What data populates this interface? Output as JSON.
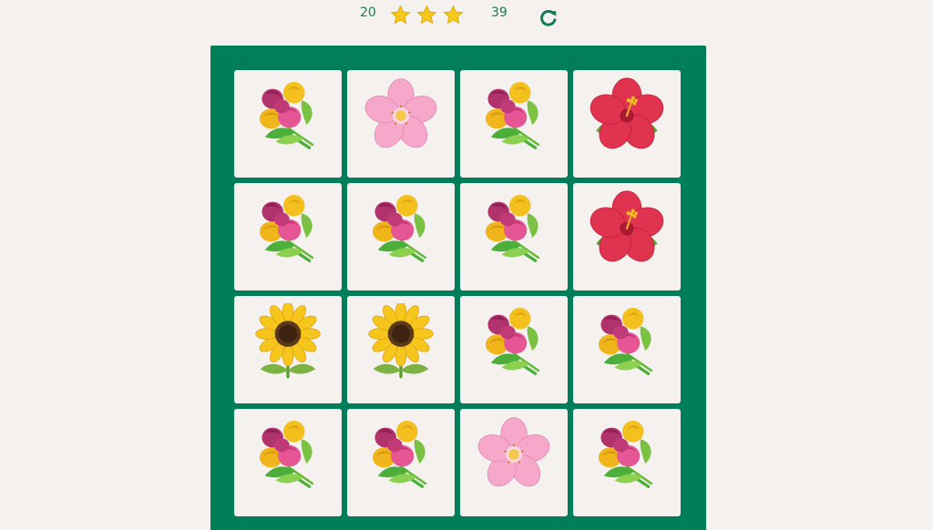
{
  "scoreboard": {
    "moves": "20",
    "timer": "39",
    "stars_filled": 3,
    "star_color": "#f6c619",
    "restart_icon": "restart-icon"
  },
  "board": {
    "background_color": "#007e5a",
    "card_color": "#f5f1ef",
    "rows": 4,
    "columns": 4,
    "cards": [
      {
        "emoji": "bouquet",
        "state": "open"
      },
      {
        "emoji": "cherry-blossom",
        "state": "open"
      },
      {
        "emoji": "bouquet",
        "state": "open"
      },
      {
        "emoji": "hibiscus",
        "state": "open"
      },
      {
        "emoji": "bouquet",
        "state": "open"
      },
      {
        "emoji": "bouquet",
        "state": "open"
      },
      {
        "emoji": "bouquet",
        "state": "open"
      },
      {
        "emoji": "hibiscus",
        "state": "open"
      },
      {
        "emoji": "sunflower",
        "state": "open"
      },
      {
        "emoji": "sunflower",
        "state": "open"
      },
      {
        "emoji": "bouquet",
        "state": "open"
      },
      {
        "emoji": "bouquet",
        "state": "open"
      },
      {
        "emoji": "bouquet",
        "state": "open"
      },
      {
        "emoji": "bouquet",
        "state": "open"
      },
      {
        "emoji": "cherry-blossom",
        "state": "open"
      },
      {
        "emoji": "bouquet",
        "state": "open"
      }
    ]
  }
}
